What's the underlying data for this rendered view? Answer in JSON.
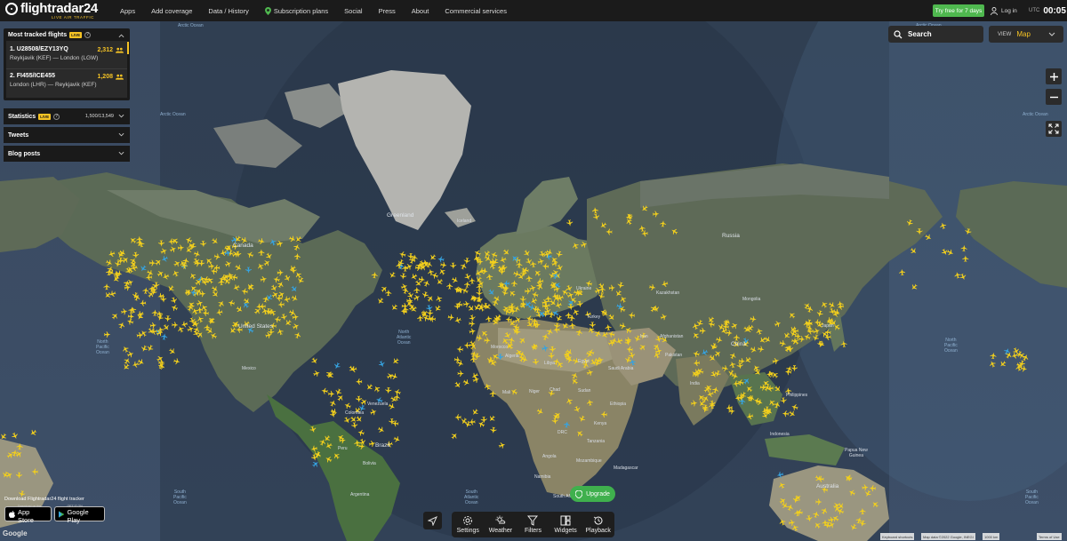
{
  "brand": {
    "name": "flightradar24",
    "tagline": "LIVE AIR TRAFFIC"
  },
  "nav": {
    "items": [
      "Apps",
      "Add coverage",
      "Data / History",
      "Subscription plans",
      "Social",
      "Press",
      "About",
      "Commercial services"
    ],
    "try_free": "Try free for 7 days",
    "login": "Log in",
    "utc_label": "UTC",
    "utc_time": "00:05"
  },
  "panel": {
    "title": "Most tracked flights",
    "live": "LIVE",
    "flights": [
      {
        "code": "1. U28508/EZY13YQ",
        "count": "2,312",
        "route": "Reykjavik (KEF) — London (LGW)"
      },
      {
        "code": "2. FI455/ICE455",
        "count": "1,208",
        "route": "London (LHR) — Reykjavik (KEF)"
      }
    ],
    "statistics": {
      "label": "Statistics",
      "live": "LIVE",
      "value": "1,500/13,549"
    },
    "tweets": "Tweets",
    "blog": "Blog posts"
  },
  "search": {
    "placeholder": "Search"
  },
  "view": {
    "label": "VIEW",
    "value": "Map"
  },
  "upgrade": "Upgrade",
  "toolbar": [
    "Settings",
    "Weather",
    "Filters",
    "Widgets",
    "Playback"
  ],
  "download": {
    "title": "Download Flightradar24 flight tracker",
    "appstore_small": "Download on the",
    "appstore": "App Store",
    "googleplay_small": "GET IT ON",
    "googleplay": "Google Play"
  },
  "google_logo": "Google",
  "attribution": [
    "Keyboard shortcuts",
    "Map data ©2022 Google, INEGI",
    "1000 km",
    "Terms of Use"
  ],
  "map_labels": {
    "arctic_ocean_1": "Arctic Ocean",
    "arctic_ocean_2": "Arctic Ocean",
    "arctic_ocean_3": "Arctic Ocean",
    "arctic_ocean_4": "Arctic Ocean",
    "greenland": "Greenland",
    "iceland": "Iceland",
    "canada": "Canada",
    "russia": "Russia",
    "north_atlantic": "North\nAtlantic\nOcean",
    "north_pacific_l": "North\nPacific\nOcean",
    "north_pacific_r": "North\nPacific\nOcean",
    "south_pacific_l": "South\nPacific\nOcean",
    "south_pacific_r": "South\nPacific\nOcean",
    "south_atlantic": "South\nAtlantic\nOcean",
    "mongolia": "Mongolia",
    "kazakhstan": "Kazakhstan",
    "china": "China",
    "india": "India",
    "algeria": "Algeria",
    "libya": "Libya",
    "egypt": "Egypt",
    "mali": "Mali",
    "niger": "Niger",
    "chad": "Chad",
    "sudan": "Sudan",
    "drc": "DRC",
    "angola": "Angola",
    "namibia": "Namibia",
    "south_africa": "South Africa",
    "brazil": "Brazil",
    "peru": "Peru",
    "bolivia": "Bolivia",
    "colombia": "Colombia",
    "venezuela": "Venezuela",
    "argentina": "Argentina",
    "mexico": "Mexico",
    "united_states": "United States",
    "australia": "Australia",
    "indonesia": "Indonesia",
    "philippines": "Philippines",
    "papua": "Papua New\nGuinea",
    "iran": "Iran",
    "saudi": "Saudi Arabia",
    "afghanistan": "Afghanistan",
    "pakistan": "Pakistan",
    "turkey": "Turkey",
    "ukraine": "Ukraine",
    "japan": "Japan",
    "morocco": "Morocco",
    "ethiopia": "Ethiopia",
    "kenya": "Kenya",
    "tanzania": "Tanzania",
    "mozambique": "Mozambique",
    "madagascar": "Madagascar"
  },
  "colors": {
    "accent": "#f5c324",
    "upgrade": "#3fb04d",
    "try_free": "#4fb84f",
    "plane": "#f2cf1d",
    "plane_alt": "#36a3e0"
  }
}
